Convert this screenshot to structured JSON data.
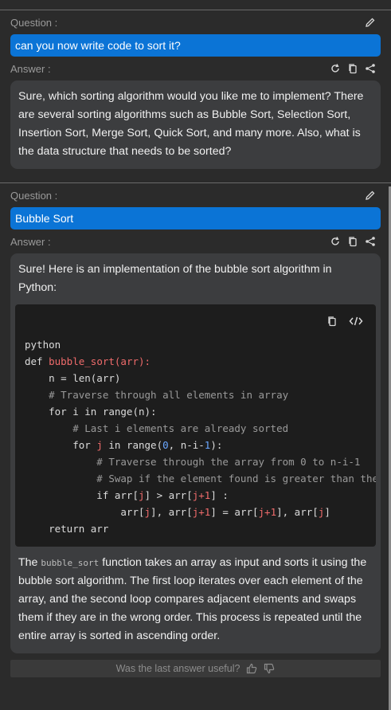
{
  "qa": [
    {
      "question_label": "Question :",
      "question": "can you now write code to sort it?",
      "answer_label": "Answer :",
      "answer": "Sure, which sorting algorithm would you like me to implement? There are several sorting algorithms such as Bubble Sort, Selection Sort, Insertion Sort, Merge Sort, Quick Sort, and many more. Also, what is the data structure that needs to be sorted?"
    },
    {
      "question_label": "Question :",
      "question": "Bubble Sort",
      "answer_label": "Answer :",
      "answer_intro": "Sure! Here is an implementation of the bubble sort algorithm in Python:",
      "code_lines": [
        "python",
        "def bubble_sort(arr):",
        "    n = len(arr)",
        "    # Traverse through all elements in array",
        "    for i in range(n):",
        "        # Last i elements are already sorted",
        "        for j in range(0, n-i-1):",
        "            # Traverse through the array from 0 to n-i-1",
        "            # Swap if the element found is greater than the next element",
        "            if arr[j] > arr[j+1] :",
        "                arr[j], arr[j+1] = arr[j+1], arr[j]",
        "    return arr"
      ],
      "answer_outro_prefix": "The ",
      "answer_outro_code": "bubble_sort",
      "answer_outro_suffix": " function takes an array as input and sorts it using the bubble sort algorithm. The first loop iterates over each element of the array, and the second loop compares adjacent elements and swaps them if they are in the wrong order. This process is repeated until the entire array is sorted in ascending order."
    }
  ],
  "feedback": {
    "prompt": "Was the last answer useful?"
  },
  "icons": {
    "edit": "pencil-icon",
    "regenerate": "refresh-icon",
    "copy": "copy-icon",
    "share": "share-icon",
    "code_view": "code-icon",
    "thumbs_up": "thumbs-up-icon",
    "thumbs_down": "thumbs-down-icon"
  },
  "colors": {
    "background": "#2b2b2b",
    "question_bg": "#0b74d6",
    "answer_bg": "#3c3d3f",
    "code_bg": "#1d1d1d",
    "code_keyword_red": "#ef6b6b",
    "code_number_blue": "#6aa7ff",
    "code_comment": "#9a9a9a"
  }
}
